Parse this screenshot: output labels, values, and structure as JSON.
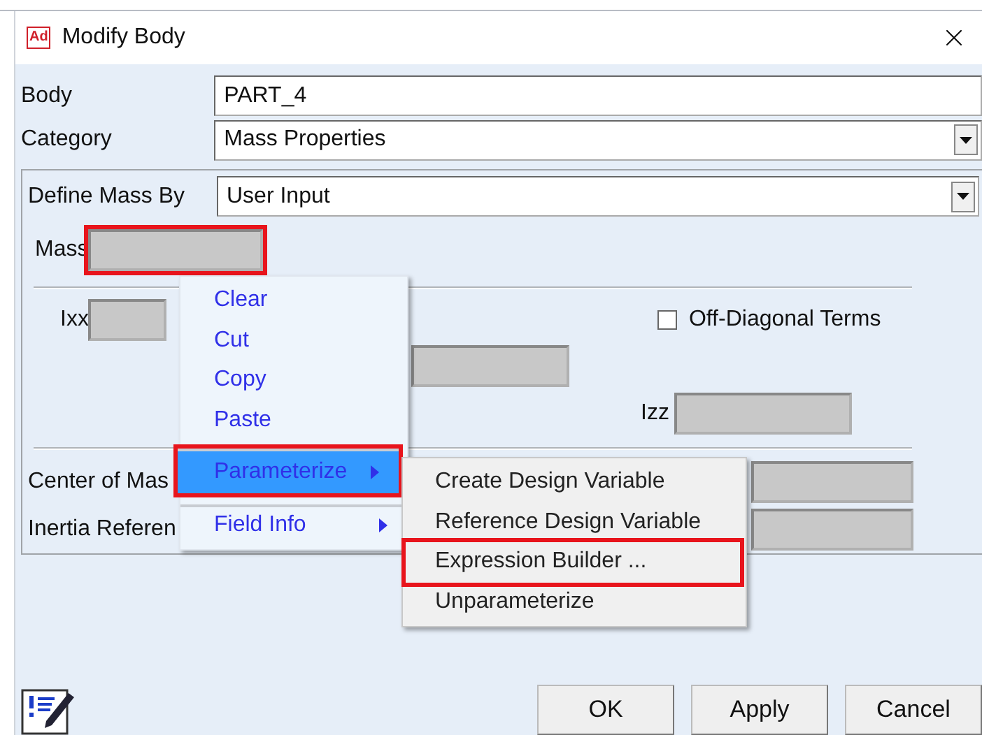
{
  "window": {
    "logo": "Ad",
    "title": "Modify Body"
  },
  "body": {
    "label": "Body",
    "value": "PART_4"
  },
  "category": {
    "label": "Category",
    "value": "Mass Properties"
  },
  "define_mass_by": {
    "label": "Define Mass By",
    "value": "User Input"
  },
  "mass": {
    "label": "Mass",
    "highlighted": true
  },
  "ixx": {
    "label": "Ixx"
  },
  "off_diagonal": {
    "label": "Off-Diagonal Terms",
    "checked": false
  },
  "izz": {
    "label": "Izz"
  },
  "center_of_mass": {
    "label": "Center of Mas"
  },
  "inertia_reference": {
    "label": "Inertia Referen"
  },
  "context_menu": [
    {
      "label": "Clear",
      "submenu": false,
      "selected": false,
      "highlighted": false,
      "separator_before": false
    },
    {
      "label": "Cut",
      "submenu": false,
      "selected": false,
      "highlighted": false,
      "separator_before": false
    },
    {
      "label": "Copy",
      "submenu": false,
      "selected": false,
      "highlighted": false,
      "separator_before": false
    },
    {
      "label": "Paste",
      "submenu": false,
      "selected": false,
      "highlighted": false,
      "separator_before": false
    },
    {
      "label": "Parameterize",
      "submenu": true,
      "selected": true,
      "highlighted": true,
      "separator_before": true
    },
    {
      "label": "Field Info",
      "submenu": true,
      "selected": false,
      "highlighted": false,
      "separator_before": true
    }
  ],
  "submenu": [
    {
      "label": "Create Design Variable",
      "highlighted": false
    },
    {
      "label": "Reference Design Variable",
      "highlighted": false
    },
    {
      "label": "Expression Builder ...",
      "highlighted": true
    },
    {
      "label": "Unparameterize",
      "highlighted": false
    }
  ],
  "buttons": [
    "OK",
    "Apply",
    "Cancel"
  ]
}
